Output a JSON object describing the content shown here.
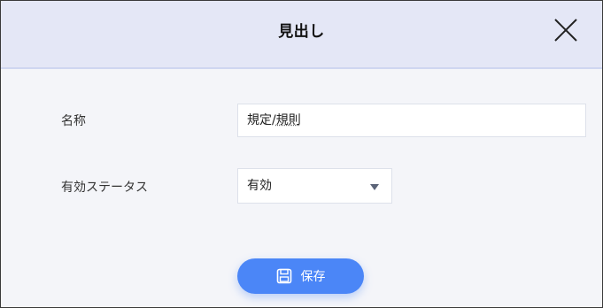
{
  "dialog": {
    "title": "見出し",
    "close_icon": "close-icon"
  },
  "form": {
    "name_label": "名称",
    "name_value_prefix": "規定/",
    "name_value_suffix": "規則",
    "status_label": "有効ステータス",
    "status_value": "有効",
    "status_icon": "chevron-down-icon"
  },
  "actions": {
    "save_label": "保存",
    "save_icon": "save-icon"
  },
  "colors": {
    "header_bg": "#e4e7f6",
    "body_bg": "#f4f5f9",
    "accent": "#4b86f7"
  }
}
